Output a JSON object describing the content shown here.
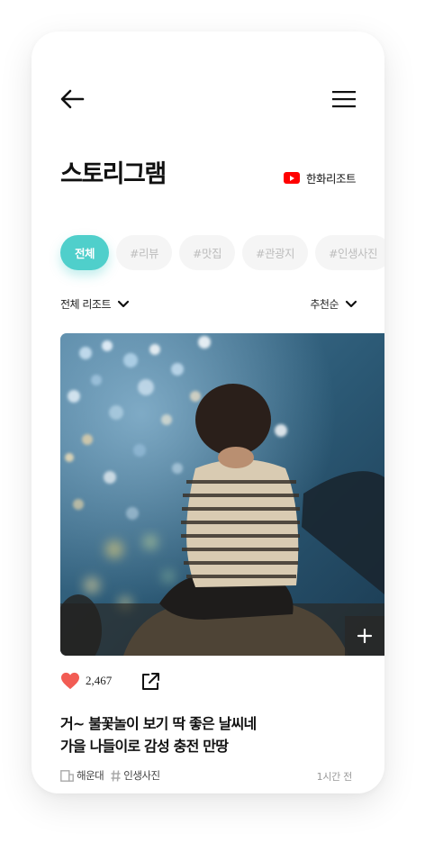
{
  "header": {
    "title": "스토리그램",
    "channel_label": "한화리조트",
    "back_icon": "arrow-left-icon",
    "menu_icon": "hamburger-menu-icon",
    "channel_icon": "youtube-icon"
  },
  "tags": [
    {
      "label": "전체",
      "active": true
    },
    {
      "label": "#리뷰",
      "active": false
    },
    {
      "label": "#맛집",
      "active": false
    },
    {
      "label": "#관광지",
      "active": false
    },
    {
      "label": "#인생사진",
      "active": false
    }
  ],
  "filters": {
    "resort_label": "전체 리조트",
    "sort_label": "추천순"
  },
  "post": {
    "like_count": "2,467",
    "headline_line1": "거~ 불꽃놀이 보기 딱 좋은 날씨네",
    "headline_line2": "가을 나들이로 감성 충전 만땅",
    "location": "해운대",
    "hashtag": "인생사진",
    "time": "1시간 전"
  },
  "colors": {
    "accent": "#4fcfcb",
    "heart": "#f25c54",
    "youtube": "#ff0000"
  }
}
